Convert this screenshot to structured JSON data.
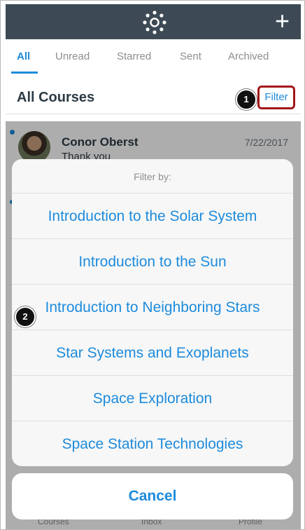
{
  "nav": {
    "plus_label": "+"
  },
  "tabs": [
    "All",
    "Unread",
    "Starred",
    "Sent",
    "Archived"
  ],
  "header": {
    "title": "All Courses",
    "filter_label": "Filter"
  },
  "messages": [
    {
      "sender": "Conor Oberst",
      "preview": "Thank you",
      "date": "7/22/2017"
    }
  ],
  "bottom_tabs": [
    "Courses",
    "Inbox",
    "Profile"
  ],
  "filter_sheet": {
    "title": "Filter by:",
    "options": [
      "Introduction to the Solar System",
      "Introduction to the Sun",
      "Introduction to Neighboring Stars",
      "Star Systems and Exoplanets",
      "Space Exploration",
      "Space Station Technologies"
    ],
    "cancel_label": "Cancel"
  },
  "callouts": [
    "1",
    "2"
  ],
  "colors": {
    "accent": "#1d8bdc",
    "navbar": "#3d4a55",
    "highlight": "#a3161b"
  }
}
